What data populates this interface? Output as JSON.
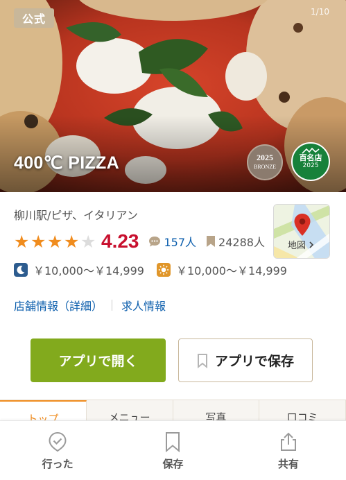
{
  "hero": {
    "official_badge": "公式",
    "photo_counter": "1/10",
    "shop_name": "400℃ PIZZA",
    "awards": {
      "bronze_year": "2025",
      "bronze_label": "BRONZE",
      "hyakumeiten_name": "百名店",
      "hyakumeiten_year": "2025"
    }
  },
  "info": {
    "area_genre": "柳川駅/ピザ、イタリアン",
    "rating": {
      "stars_filled": 4,
      "stars_total": 5,
      "score": "4.23",
      "review_count": "157人",
      "save_count": "24288人"
    },
    "map_label": "地図",
    "dinner_price": "￥10,000～￥14,999",
    "lunch_price": "￥10,000～￥14,999",
    "links": {
      "detail": "店舗情報（詳細）",
      "jobs": "求人情報"
    }
  },
  "actions": {
    "open_app": "アプリで開く",
    "save_app": "アプリで保存"
  },
  "tabs": [
    "トップ",
    "メニュー",
    "写真",
    "口コミ"
  ],
  "bottom_bar": {
    "went": "行った",
    "save": "保存",
    "share": "共有"
  },
  "colors": {
    "accent_orange": "#f08c1e",
    "score_red": "#c8102e",
    "link_blue": "#0d5fad",
    "primary_green": "#82aa1d",
    "hyakumei_green": "#17813a"
  },
  "icons": [
    "chat-bubble-icon",
    "bookmark-icon",
    "moon-icon",
    "sun-icon",
    "map-pin-icon",
    "chevron-right-icon",
    "check-badge-icon",
    "share-icon"
  ]
}
